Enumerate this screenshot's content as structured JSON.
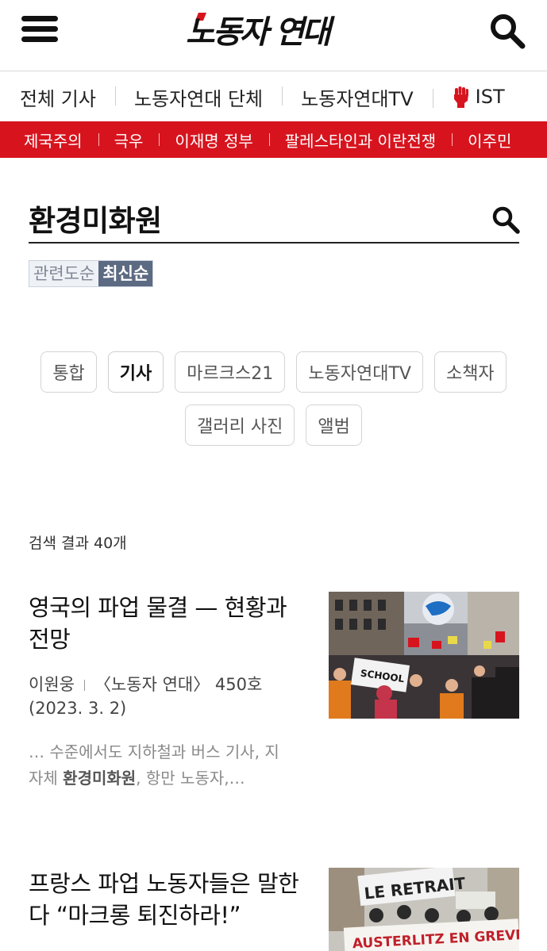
{
  "header": {
    "logo_text": "노동자 연대",
    "logo_color": "#111111",
    "logo_accent": "#d7141e"
  },
  "nav": {
    "items": [
      {
        "label": "전체 기사"
      },
      {
        "label": "노동자연대 단체"
      },
      {
        "label": "노동자연대TV"
      },
      {
        "label": "IST",
        "icon": "raised-fist-icon"
      }
    ]
  },
  "topics": {
    "background": "#d7141e",
    "items": [
      "제국주의",
      "극우",
      "이재명 정부",
      "팔레스타인과 이란전쟁",
      "이주민"
    ]
  },
  "search": {
    "term": "환경미화원",
    "sort_options": [
      {
        "label": "관련도순",
        "active": false
      },
      {
        "label": "최신순",
        "active": true
      }
    ]
  },
  "filters": [
    {
      "label": "통합",
      "active": false
    },
    {
      "label": "기사",
      "active": true
    },
    {
      "label": "마르크스21",
      "active": false
    },
    {
      "label": "노동자연대TV",
      "active": false
    },
    {
      "label": "소책자",
      "active": false
    },
    {
      "label": "갤러리 사진",
      "active": false
    },
    {
      "label": "앨범",
      "active": false
    }
  ],
  "results": {
    "count_text": "검색 결과 40개"
  },
  "articles": [
    {
      "title": "영국의 파업 물결 — 현황과 전망",
      "author": "이원웅",
      "issue": "〈노동자 연대〉 450호",
      "date": "(2023. 3. 2)",
      "excerpt_before": "… 수준에서도 지하철과 버스 기사, 지자체 ",
      "excerpt_highlight": "환경미화원",
      "excerpt_after": ", 항만 노동자,…",
      "image_label": "SCHOOL"
    },
    {
      "title": "프랑스 파업 노동자들은 말한다 “마크롱 퇴진하라!”",
      "banner_text_1": "LE RETRAIT",
      "banner_text_2": "AUSTERLITZ EN GREVE"
    }
  ]
}
